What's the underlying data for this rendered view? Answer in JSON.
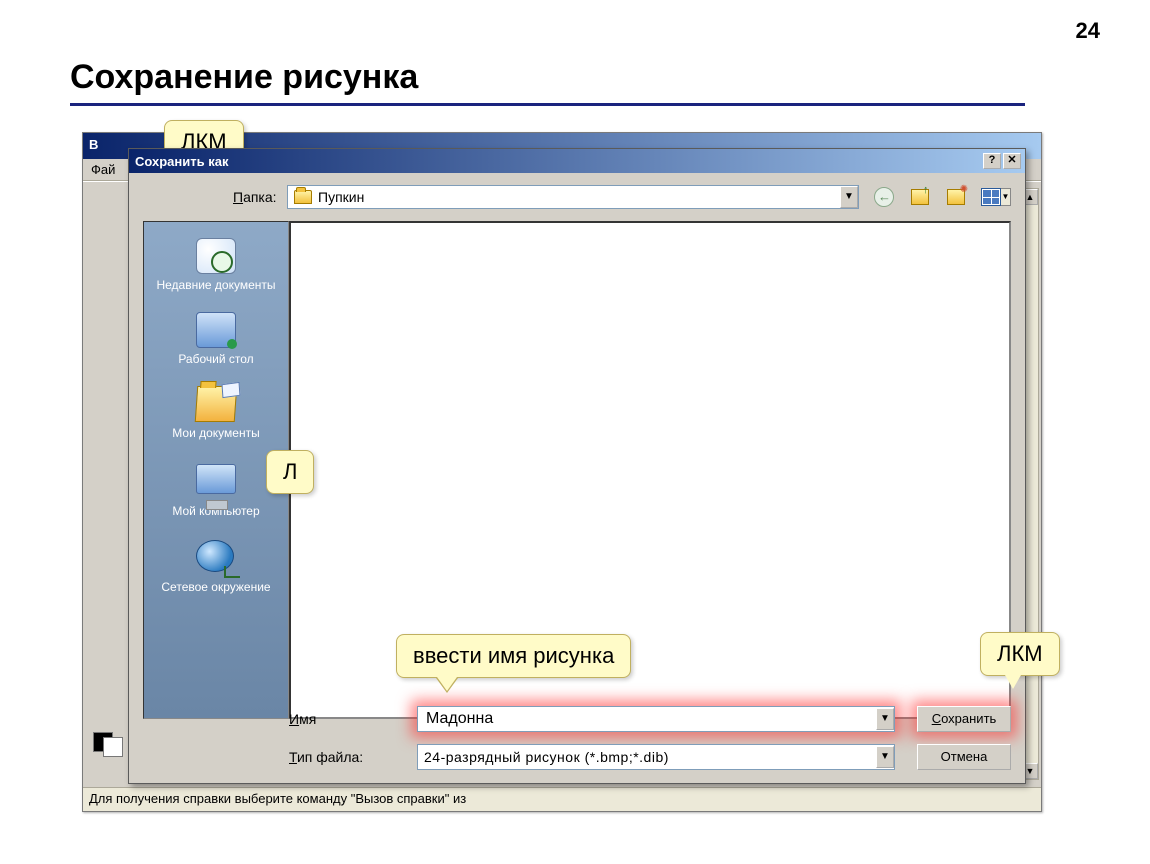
{
  "page": {
    "number": "24",
    "title": "Сохранение рисунка"
  },
  "paint": {
    "title_prefix": "В",
    "menu_file": "Фай",
    "statusbar": "Для получения справки выберите команду \"Вызов справки\" из"
  },
  "callouts": {
    "top_partial": "ЛКМ",
    "left_partial": "Л",
    "filename_hint": "ввести имя рисунка",
    "lkm": "ЛКМ"
  },
  "saveas": {
    "title": "Сохранить как",
    "folder_label": "Папка:",
    "folder_label_u": "П",
    "folder_label_rest": "апка:",
    "folder_value": "Пупкин",
    "places": {
      "recent": "Недавние документы",
      "desktop": "Рабочий стол",
      "mydocs": "Мои документы",
      "computer": "Мой компьютер",
      "network": "Сетевое окружение"
    },
    "name_label_u": "И",
    "name_label_rest": "мя",
    "name_value": "Мадонна",
    "type_label_u": "Т",
    "type_label_rest": "ип файла:",
    "type_value": "24-разрядный рисунок (*.bmp;*.dib)",
    "save_btn": "Сохранить",
    "save_btn_u": "С",
    "save_btn_rest": "охранить",
    "cancel_btn": "Отмена"
  }
}
